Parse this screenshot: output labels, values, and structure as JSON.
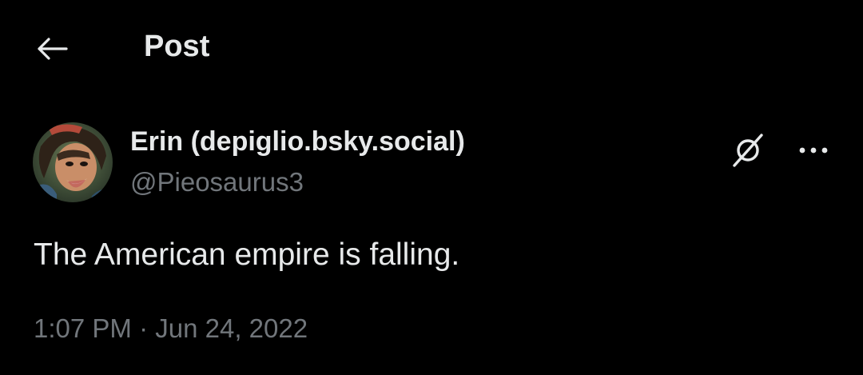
{
  "header": {
    "back_icon": "arrow-left-icon",
    "title": "Post"
  },
  "author": {
    "avatar_icon": "avatar",
    "display_name": "Erin (depiglio.bsky.social)",
    "handle": "@Pieosaurus3"
  },
  "actions": {
    "grok_icon": "grok-icon",
    "more_icon": "more-horizontal-icon"
  },
  "post": {
    "text": "The American empire is falling.",
    "time": "1:07 PM",
    "separator": "·",
    "date": "Jun 24, 2022"
  },
  "colors": {
    "background": "#000000",
    "primary_text": "#e7e9ea",
    "secondary_text": "#71767b"
  }
}
